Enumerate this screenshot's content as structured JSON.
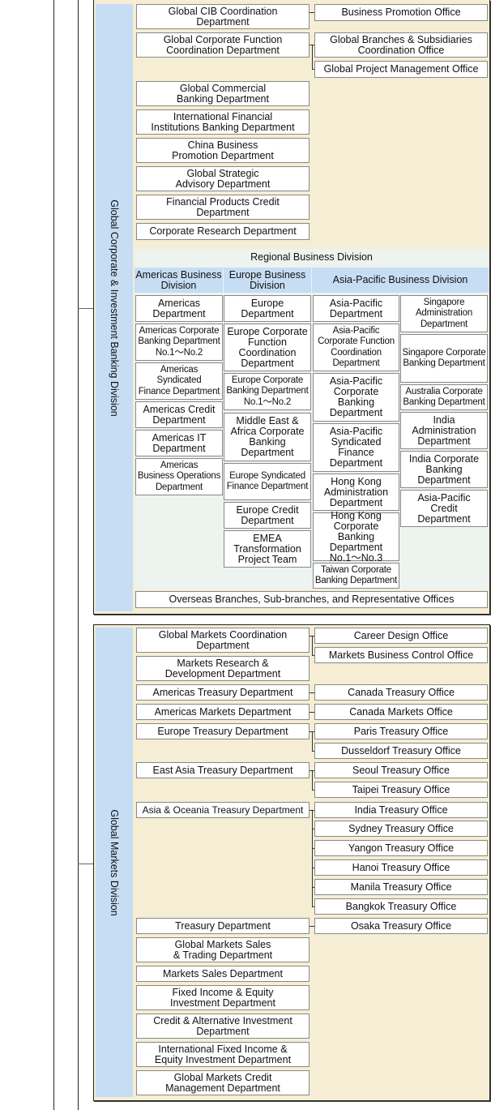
{
  "cib": {
    "division_label": "Global Corporate & Investment Banking Division",
    "left_departments": [
      "Global CIB Coordination\nDepartment",
      "Global Corporate Function\nCoordination Department",
      "Global Commercial\nBanking Department",
      "International Financial\nInstitutions Banking Department",
      "China Business\nPromotion Department",
      "Global Strategic\nAdvisory Department",
      "Financial Products Credit\nDepartment",
      "Corporate Research Department"
    ],
    "offices": [
      "Business Promotion Office",
      "Global Branches & Subsidiaries\nCoordination Office",
      "Global Project Management Office"
    ],
    "regional": {
      "title": "Regional Business Division",
      "americas": {
        "header": "Americas Business\nDivision",
        "departments": [
          "Americas\nDepartment",
          "Americas Corporate\nBanking Department\nNo.1～No.2",
          "Americas\nSyndicated\nFinance Department",
          "Americas Credit\nDepartment",
          "Americas IT\nDepartment",
          "Americas\nBusiness Operations\nDepartment"
        ]
      },
      "europe": {
        "header": "Europe Business\nDivision",
        "departments": [
          "Europe\nDepartment",
          "Europe Corporate\nFunction\nCoordination\nDepartment",
          "Europe Corporate\nBanking Department\nNo.1～No.2",
          "Middle East &\nAfrica Corporate\nBanking\nDepartment",
          "Europe Syndicated\nFinance Department",
          "Europe Credit\nDepartment",
          "EMEA\nTransformation\nProject Team"
        ]
      },
      "asia_pacific": {
        "header": "Asia-Pacific Business Division",
        "col1": [
          "Asia-Pacific\nDepartment",
          "Asia-Pacific\nCorporate Function\nCoordination\nDepartment",
          "Asia-Pacific\nCorporate\nBanking\nDepartment",
          "Asia-Pacific\nSyndicated\nFinance\nDepartment",
          "Hong Kong\nAdministration\nDepartment",
          "Hong Kong\nCorporate Banking\nDepartment\nNo.1～No.3",
          "Taiwan Corporate\nBanking Department"
        ],
        "col2": [
          "Singapore\nAdministration\nDepartment",
          "Singapore Corporate\nBanking Department",
          "Australia Corporate\nBanking Department",
          "India Administration\nDepartment",
          "India Corporate\nBanking\nDepartment",
          "Asia-Pacific Credit\nDepartment"
        ]
      }
    },
    "overseas": "Overseas Branches, Sub-branches, and Representative Offices"
  },
  "markets": {
    "division_label": "Global Markets Division",
    "departments": [
      "Global Markets Coordination\nDepartment",
      "Markets Research &\nDevelopment Department",
      "Americas Treasury Department",
      "Americas Markets Department",
      "Europe Treasury Department",
      "East Asia Treasury Department",
      "Asia & Oceania Treasury Department",
      "Treasury Department",
      "Global Markets Sales\n& Trading Department",
      "Markets Sales Department",
      "Fixed Income & Equity\nInvestment Department",
      "Credit & Alternative Investment\nDepartment",
      "International Fixed Income &\nEquity Investment Department",
      "Global Markets Credit\nManagement Department"
    ],
    "offices": [
      "Career Design Office",
      "Markets Business Control Office",
      "Canada Treasury Office",
      "Canada Markets Office",
      "Paris Treasury Office",
      "Dusseldorf Treasury Office",
      "Seoul Treasury Office",
      "Taipei Treasury Office",
      "India Treasury Office",
      "Sydney Treasury Office",
      "Yangon Treasury Office",
      "Hanoi Treasury Office",
      "Manila Treasury Office",
      "Bangkok Treasury Office",
      "Osaka Treasury Office"
    ]
  }
}
